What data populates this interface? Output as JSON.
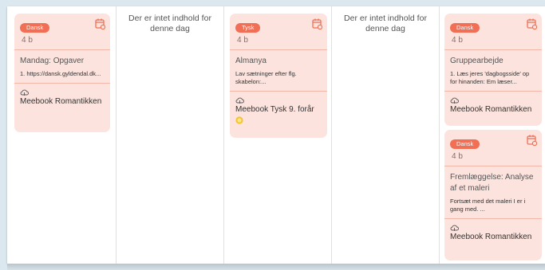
{
  "days": [
    {
      "empty": false,
      "cards": [
        {
          "subject": "Dansk",
          "class_label": "4 b",
          "title": "Mandag: Opgaver",
          "description": "1. https://dansk.gyldendal.dk...",
          "source": "Meebook Romantikken"
        }
      ]
    },
    {
      "empty": true,
      "empty_text": "Der er intet indhold for denne dag"
    },
    {
      "empty": false,
      "cards": [
        {
          "subject": "Tysk",
          "class_label": "4 b",
          "title": "Almanya",
          "description": "Lav sætninger efter flg. skabelon:...",
          "source": "Meebook Tysk 9. forår",
          "extra_icon": "sun-emoji-icon"
        }
      ]
    },
    {
      "empty": true,
      "empty_text": "Der er intet indhold for denne dag"
    },
    {
      "empty": false,
      "cards": [
        {
          "subject": "Dansk",
          "class_label": "4 b",
          "title": "Gruppearbejde",
          "description": "1. Læs jeres 'dagbogsside' op for hinanden: Em læser...",
          "source": "Meebook Romantikken"
        },
        {
          "subject": "Dansk",
          "class_label": "4 b",
          "title": "Fremlæggelse: Analyse af et maleri",
          "description": "Fortsæt med det maleri I er i gang med. ...",
          "source": "Meebook Romantikken"
        }
      ]
    }
  ],
  "colors": {
    "card_bg": "#fde3dd",
    "badge_bg": "#f06f55",
    "accent": "#f06f55",
    "page_bg": "#dbe8ef"
  },
  "icons": {
    "calendar": "calendar-icon",
    "cloud": "cloud-icon",
    "sun": "sun-emoji-icon"
  }
}
